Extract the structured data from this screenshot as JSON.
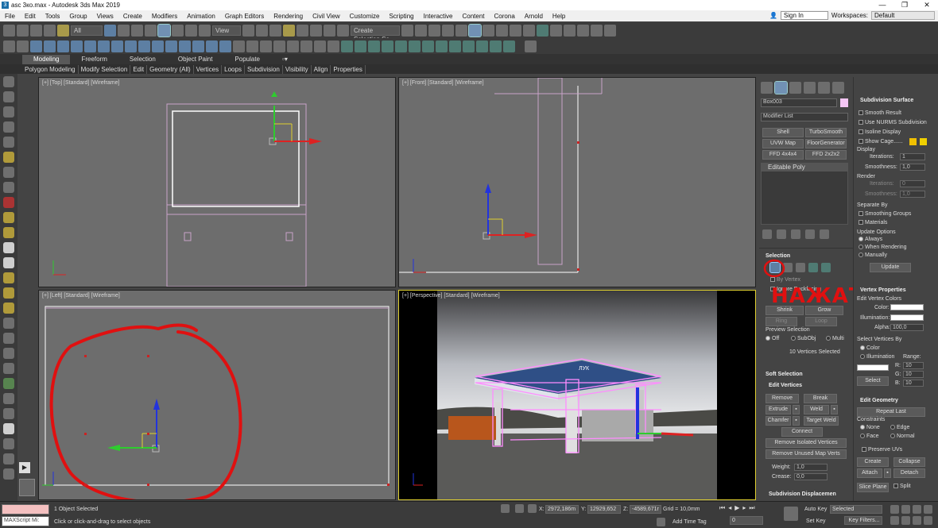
{
  "window": {
    "title": "asc 3ко.max - Autodesk 3ds Max 2019",
    "controls": [
      "—",
      "❐",
      "✕"
    ]
  },
  "menu": {
    "items": [
      "File",
      "Edit",
      "Tools",
      "Group",
      "Views",
      "Create",
      "Modifiers",
      "Animation",
      "Graph Editors",
      "Rendering",
      "Civil View",
      "Customize",
      "Scripting",
      "Interactive",
      "Content",
      "Corona",
      "Arnold",
      "Help"
    ],
    "sign_in": "Sign In",
    "workspaces_label": "Workspaces:",
    "workspace_value": "Default"
  },
  "toolbar": {
    "filter_value": "All",
    "ref_coord_value": "View",
    "selection_set_placeholder": "Create Selection Se"
  },
  "ribbon": {
    "tabs": [
      "Modeling",
      "Freeform",
      "Selection",
      "Object Paint",
      "Populate"
    ],
    "active_tab": "Modeling",
    "subitems": [
      "Polygon Modeling",
      "Modify Selection",
      "Edit",
      "Geometry (All)",
      "Vertices",
      "Loops",
      "Subdivision",
      "Visibility",
      "Align",
      "Properties"
    ]
  },
  "viewports": {
    "top": "[+] [Top] [Standard] [Wireframe]",
    "front": "[+] [Front] [Standard] [Wireframe]",
    "left": "[+] [Left] [Standard] [Wireframe]",
    "perspective": "[+] [Perspective] [Standard] [Wireframe]",
    "photo_sign": "ЛУК"
  },
  "command_panel": {
    "object_name": "Box003",
    "modifier_list": "Modifier List",
    "modifier_buttons": [
      "Shell",
      "TurboSmooth",
      "UVW Map",
      "FloorGenerator",
      "FFD 4x4x4",
      "FFD 2x2x2"
    ],
    "stack_item": "Editable Poly",
    "selection_header": "Selection",
    "by_vertex": "By Vertex",
    "ignore_backfacing": "Ignore Backfacing",
    "shrink": "Shrink",
    "grow": "Grow",
    "ring": "Ring",
    "loop": "Loop",
    "preview_selection": "Preview Selection",
    "preview_opts": [
      "Off",
      "SubObj",
      "Multi"
    ],
    "vertices_selected": "10 Vertices Selected",
    "soft_selection": "Soft Selection",
    "edit_vertices": "Edit Vertices",
    "ev_buttons": [
      "Remove",
      "Break",
      "Extrude",
      "Weld",
      "Chamfer",
      "Target Weld",
      "Connect",
      "Remove Isolated Vertices",
      "Remove Unused Map Verts"
    ],
    "weight_label": "Weight:",
    "weight_value": "1,0",
    "crease_label": "Crease:",
    "crease_value": "0,0",
    "subdivision_displacement": "Subdivision Displacemen",
    "annotation": "НАЖАТЬ"
  },
  "rollout": {
    "subdivision_surface": "Subdivision Surface",
    "smooth_result": "Smooth Result",
    "use_nurms": "Use NURMS Subdivision",
    "isoline_display": "Isoline Display",
    "show_cage": "Show Cage......",
    "display": "Display",
    "iterations_label": "Iterations:",
    "iterations_value": "1",
    "smoothness_label": "Smoothness:",
    "smoothness_value": "1,0",
    "render": "Render",
    "render_iter_value": "0",
    "render_smooth_value": "1,0",
    "separate_by": "Separate By",
    "smoothing_groups": "Smoothing Groups",
    "materials": "Materials",
    "update_options": "Update Options",
    "update_opts": [
      "Always",
      "When Rendering",
      "Manually"
    ],
    "update_button": "Update",
    "vertex_properties": "Vertex Properties",
    "edit_vertex_colors": "Edit Vertex Colors",
    "color_label": "Color:",
    "illumination_label": "Illumination:",
    "alpha_label": "Alpha:",
    "alpha_value": "100,0",
    "select_vertices_by": "Select Vertices By",
    "color_opt": "Color",
    "illum_opt": "Illumination",
    "range_label": "Range:",
    "r_label": "R:",
    "r_value": "10",
    "g_label": "G:",
    "g_value": "10",
    "b_label": "B:",
    "b_value": "10",
    "select_button": "Select",
    "edit_geometry": "Edit Geometry",
    "repeat_last": "Repeat Last",
    "constraints": "Constraints",
    "constraint_opts": [
      "None",
      "Edge",
      "Face",
      "Normal"
    ],
    "preserve_uvs": "Preserve UVs",
    "create": "Create",
    "collapse": "Collapse",
    "attach": "Attach",
    "detach": "Detach",
    "slice_plane": "Slice Plane",
    "split": "Split"
  },
  "status": {
    "maxscript": "MAXScript Mi:",
    "objects_selected": "1 Object Selected",
    "prompt": "Click or click-and-drag to select objects",
    "x_label": "X:",
    "x_value": "2972,186m",
    "y_label": "Y:",
    "y_value": "12929,652",
    "z_label": "Z:",
    "z_value": "-4589,671r",
    "grid": "Grid = 10,0mm",
    "add_time_tag": "Add Time Tag",
    "auto_key": "Auto Key",
    "set_key": "Set Key",
    "selected_value": "Selected",
    "key_filters": "Key Filters...",
    "frame_value": "0"
  },
  "colors": {
    "accent": "#7191b4",
    "annotation": "#e01010",
    "selected_viewport": "#e0d030"
  }
}
